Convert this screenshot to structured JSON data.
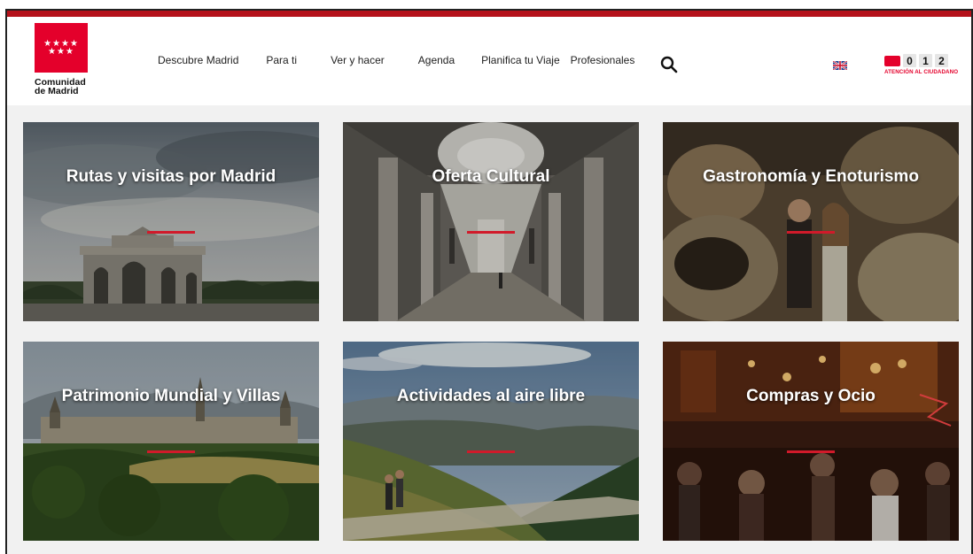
{
  "header": {
    "logo_name_line1": "Comunidad",
    "logo_name_line2": "de Madrid",
    "logo_stars_top": "★★★★",
    "logo_stars_bottom": "★★★",
    "nav": [
      "Descubre Madrid",
      "Para ti",
      "Ver y hacer",
      "Agenda",
      "Planifica tu Viaje",
      "Profesionales"
    ],
    "search_icon": "search-icon",
    "language_icon": "uk-flag-icon",
    "atencion": {
      "digits": [
        "0",
        "1",
        "2"
      ],
      "label": "ATENCIÓN AL CIUDADANO",
      "icon": "phone-icon"
    }
  },
  "cards": [
    {
      "title": "Rutas y visitas por Madrid"
    },
    {
      "title": "Oferta Cultural"
    },
    {
      "title": "Gastronomía y Enoturismo"
    },
    {
      "title": "Patrimonio Mundial y Villas"
    },
    {
      "title": "Actividades al aire libre"
    },
    {
      "title": "Compras y Ocio"
    }
  ],
  "colors": {
    "brand_red": "#e4002b",
    "top_bar": "#b5121b",
    "accent_bar": "#d11a2a"
  }
}
